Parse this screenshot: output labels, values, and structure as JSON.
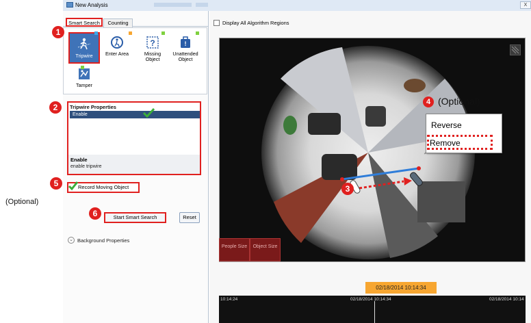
{
  "window": {
    "title": "New Analysis",
    "close_label": "X"
  },
  "tabs": [
    {
      "label": "Smart Search"
    },
    {
      "label": "Counting"
    }
  ],
  "algorithms": [
    {
      "label_line1": "Tripwire",
      "label_line2": "",
      "icon": "tripwire-icon"
    },
    {
      "label_line1": "Enter Area",
      "label_line2": "",
      "icon": "enter-area-icon"
    },
    {
      "label_line1": "Missing",
      "label_line2": "Object",
      "icon": "missing-object-icon"
    },
    {
      "label_line1": "Unattended",
      "label_line2": "Object",
      "icon": "unattended-object-icon"
    },
    {
      "label_line1": "Tamper",
      "label_line2": "",
      "icon": "tamper-icon"
    }
  ],
  "properties": {
    "title": "Tripwire Properties",
    "row_label": "Enable",
    "desc_title": "Enable",
    "desc_text": "enable tripwire"
  },
  "record": {
    "label": "Record Moving Object",
    "checked": true
  },
  "buttons": {
    "start": "Start Smart Search",
    "reset": "Reset"
  },
  "background_properties": {
    "label": "Background Properties"
  },
  "display_all": {
    "label": "Display All Algorithm Regions",
    "checked": false
  },
  "video": {
    "people_size": "People Size",
    "object_size": "Object Size"
  },
  "context_menu": {
    "items": [
      "Reverse",
      "Remove"
    ]
  },
  "annotations": {
    "steps": [
      "1",
      "2",
      "3",
      "4",
      "5",
      "6"
    ],
    "optional_right": "(Optional)",
    "optional_left": "(Optional)"
  },
  "timeline": {
    "current": "02/18/2014 10:14:34",
    "left": "10:14:24",
    "mid": "02/18/2014 10:14:34",
    "right": "02/18/2014 10:14"
  },
  "colors": {
    "accent_red": "#e0201f",
    "selected_blue": "#3f73b8",
    "timestamp_orange": "#f7a631"
  }
}
